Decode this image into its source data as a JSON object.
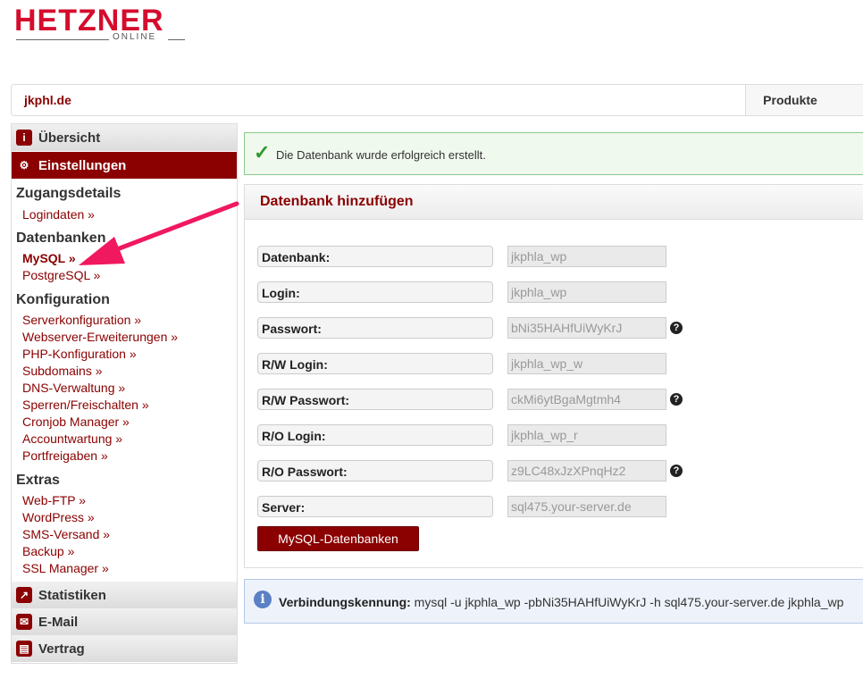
{
  "logo": {
    "main": "HETZNER",
    "sub": "ONLINE"
  },
  "topbar": {
    "domain": "jkphl.de",
    "products": "Produkte"
  },
  "sidebar": {
    "overview": "Übersicht",
    "settings": "Einstellungen",
    "sections": [
      {
        "title": "Zugangsdetails",
        "links": [
          "Logindaten »"
        ]
      },
      {
        "title": "Datenbanken",
        "links": [
          "MySQL »",
          "PostgreSQL »"
        ]
      },
      {
        "title": "Konfiguration",
        "links": [
          "Serverkonfiguration »",
          "Webserver-Erweiterungen »",
          "PHP-Konfiguration »",
          "Subdomains »",
          "DNS-Verwaltung »",
          "Sperren/Freischalten »",
          "Cronjob Manager »",
          "Accountwartung »",
          "Portfreigaben »"
        ]
      },
      {
        "title": "Extras",
        "links": [
          "Web-FTP »",
          "WordPress »",
          "SMS-Versand »",
          "Backup »",
          "SSL Manager »"
        ]
      }
    ],
    "bottom": [
      "Statistiken",
      "E-Mail",
      "Vertrag"
    ]
  },
  "success": {
    "message": "Die Datenbank wurde erfolgreich erstellt."
  },
  "panel": {
    "title": "Datenbank hinzufügen",
    "fields": [
      {
        "label": "Datenbank:",
        "value": "jkphla_wp"
      },
      {
        "label": "Login:",
        "value": "jkphla_wp"
      },
      {
        "label": "Passwort:",
        "value": "bNi35HAHfUiWyKrJ"
      },
      {
        "label": "R/W Login:",
        "value": "jkphla_wp_w"
      },
      {
        "label": "R/W Passwort:",
        "value": "ckMi6ytBgaMgtmh4"
      },
      {
        "label": "R/O Login:",
        "value": "jkphla_wp_r"
      },
      {
        "label": "R/O Passwort:",
        "value": "z9LC48xJzXPnqHz2"
      },
      {
        "label": "Server:",
        "value": "sql475.your-server.de"
      }
    ],
    "help_mark": "?",
    "button": "MySQL-Datenbanken"
  },
  "info": {
    "label": "Verbindungskennung:",
    "command": "mysql -u jkphla_wp -pbNi35HAHfUiWyKrJ -h sql475.your-server.de jkphla_wp"
  },
  "colors": {
    "brand": "#d50c2d",
    "accent": "#8b0000",
    "arrow": "#f0185f"
  }
}
